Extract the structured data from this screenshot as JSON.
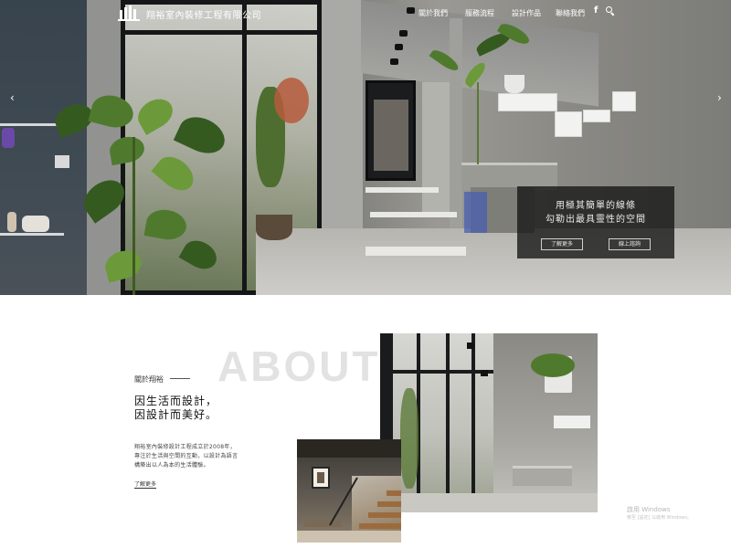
{
  "header": {
    "company_name": "翔裕室內裝修工程有限公司",
    "nav": [
      "關於我們",
      "服務流程",
      "設計作品",
      "聯絡我們"
    ],
    "facebook_icon_text": "f"
  },
  "hero": {
    "caption_line1": "用極其簡單的線條",
    "caption_line2": "勾勒出最具靈性的空間",
    "btn_more": "了解更多",
    "btn_contact": "線上諮詢",
    "prev_arrow": "‹",
    "next_arrow": "›"
  },
  "about": {
    "bg_word": "ABOUT",
    "tag": "關於翔裕",
    "headline1": "因生活而設計，",
    "headline2": "因設計而美好。",
    "body1": "翔裕室內裝修設計工程成立於2008年，",
    "body2": "專注於生活與空間的互動，以設計為語言",
    "body3": "構築出以人為本的生活體驗。",
    "link": "了解更多"
  },
  "watermark": {
    "line1": "啟用 Windows",
    "line2": "移至 [設定] 以啟用 Windows。"
  }
}
